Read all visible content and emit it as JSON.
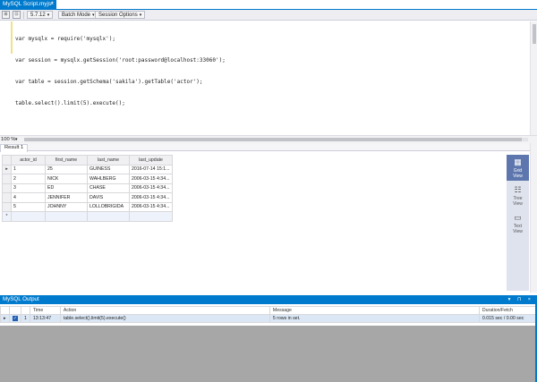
{
  "document_tab": {
    "title": "MySQL Script.myjs*",
    "close_glyph": "×"
  },
  "toolbar": {
    "icon1": "⊞",
    "icon2": "⊡",
    "version": "5.7.12",
    "batch_mode": "Batch Mode",
    "session_options": "Session Options",
    "caret": "▾"
  },
  "editor": {
    "lines": [
      "var mysqlx = require('mysqlx');",
      "var session = mysqlx.getSession('root:password@localhost:33060');",
      "var table = session.getSchema('sakila').getTable('actor');",
      "table.select().limit(5).execute();"
    ]
  },
  "zoom": {
    "value": "100 %",
    "caret": "▾"
  },
  "results": {
    "tab_label": "Result 1",
    "columns": [
      "actor_id",
      "first_name",
      "last_name",
      "last_update"
    ],
    "rows": [
      [
        "1",
        "25",
        "GUINESS",
        "2016-07-14 15:1..."
      ],
      [
        "2",
        "NICK",
        "WAHLBERG",
        "2006-03-15 4:34..."
      ],
      [
        "3",
        "ED",
        "CHASE",
        "2006-03-15 4:34..."
      ],
      [
        "4",
        "JENNIFER",
        "DAVIS",
        "2006-03-15 4:34..."
      ],
      [
        "5",
        "JOHNNY",
        "LOLLOBRIGIDA",
        "2006-03-15 4:34..."
      ]
    ],
    "row_marker": "▸",
    "new_row_marker": "*",
    "views": [
      {
        "label_line1": "Grid",
        "label_line2": "View",
        "icon": "grid-icon",
        "active": true
      },
      {
        "label_line1": "Tree",
        "label_line2": "View",
        "icon": "tree-icon",
        "active": false
      },
      {
        "label_line1": "Text",
        "label_line2": "View",
        "icon": "text-icon",
        "active": false
      }
    ]
  },
  "output": {
    "title": "MySQL Output",
    "controls": "▾ ⊓ ×",
    "columns": [
      "Time",
      "Action",
      "Message",
      "Duration/Fetch"
    ],
    "rows": [
      {
        "index": "1",
        "time": "13:13:47",
        "action": "table.select().limit(5).execute()",
        "message": "5 rows in set.",
        "duration": "0.015 sec / 0.00 sec"
      }
    ],
    "check": "✓",
    "row_marker": "▸"
  },
  "colors": {
    "accent": "#007acc",
    "active_view": "#5d76ad",
    "output_area_gray": "#a7a7a7"
  }
}
